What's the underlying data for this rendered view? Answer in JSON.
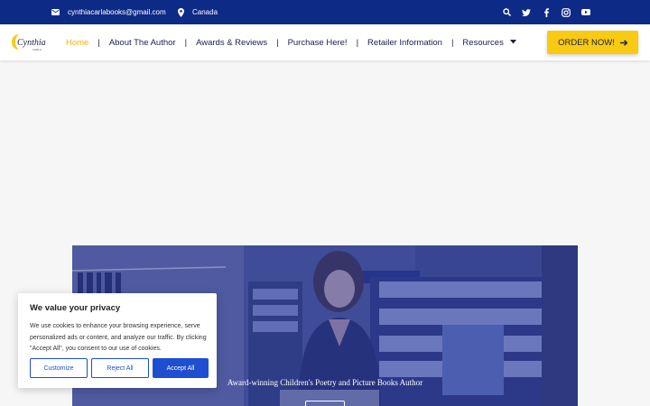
{
  "topbar": {
    "email": "cynthiacarlabooks@gmail.com",
    "location": "Canada",
    "socials": [
      "search-icon",
      "twitter-icon",
      "facebook-icon",
      "instagram-icon",
      "youtube-icon"
    ],
    "bg_color": "#0d2a86"
  },
  "logo": {
    "text": "Cynthia",
    "sub": "CARLA"
  },
  "nav": {
    "items": [
      "Home",
      "About The Author",
      "Awards & Reviews",
      "Purchase Here!",
      "Retailer Information",
      "Resources"
    ],
    "active": "Home",
    "separator": "|"
  },
  "cta": {
    "label": "ORDER NOW!",
    "color": "#f8ca12"
  },
  "hero": {
    "tagline": "Award-winning Children's Poetry and Picture Books Author"
  },
  "cookie": {
    "title": "We value your privacy",
    "body": "We use cookies to enhance your browsing experience, serve personalized ads or content, and analyze our traffic. By clicking \"Accept All\", you consent to our use of cookies.",
    "customize": "Customize",
    "reject": "Reject All",
    "accept": "Accept All",
    "accent": "#1e4fd0"
  }
}
